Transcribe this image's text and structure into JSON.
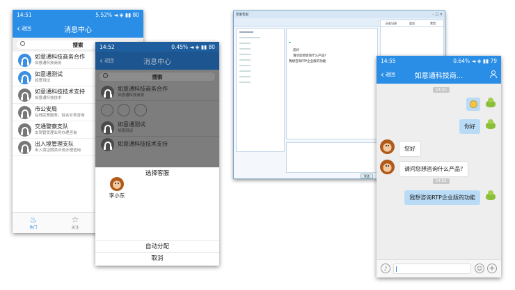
{
  "phone1": {
    "time": "14:51",
    "status_right": "5.52%",
    "battery": "80",
    "back": "返回",
    "title": "消息中心",
    "search": "搜索",
    "items": [
      {
        "name": "如意通科技商务合作",
        "sub": "如意通科技商务"
      },
      {
        "name": "如意通测试",
        "sub": "如意测试"
      },
      {
        "name": "如意通科技技术支持",
        "sub": "如意通科技技术"
      },
      {
        "name": "市公安局",
        "sub": "在线民警服务，综合业务咨询"
      },
      {
        "name": "交通警察支队",
        "sub": "车驾管受理业务办理咨询"
      },
      {
        "name": "出入境管理支队",
        "sub": "出入境证照类业务办理咨询"
      }
    ],
    "tabs": [
      {
        "label": "热门"
      },
      {
        "label": "关注"
      }
    ]
  },
  "phone2": {
    "time": "14:52",
    "status_right": "0.45%",
    "battery": "80",
    "back": "返回",
    "title": "消息中心",
    "search": "搜索",
    "items": [
      {
        "name": "如意通科技商务合作",
        "sub": "如意通科技商务"
      },
      {
        "name": "如意通测试",
        "sub": "如意测试"
      },
      {
        "name": "如意通科技技术支持",
        "sub": ""
      }
    ],
    "sheet_title": "选择客服",
    "agent_name": "李小东",
    "auto_assign": "自动分配",
    "cancel": "取消"
  },
  "desktop": {
    "title": "客服客服",
    "tabs": [
      "历史记录",
      "会员",
      "常用"
    ],
    "msgs": [
      "您好",
      "请问您想咨询什么产品?",
      "我想咨询RTP企业版的功能"
    ],
    "send": "发送"
  },
  "phone3": {
    "time": "14:55",
    "status_right": "0.64%",
    "battery": "79",
    "back": "返回",
    "title": "如意通科技商...",
    "ts1": "14:52",
    "ts2": "14:55",
    "msg_me_1": "你好",
    "msg_other_1": "您好",
    "msg_other_2": "请问您想咨询什么产品?",
    "msg_me_2": "我想咨询RTP企业版的功能"
  },
  "colors": {
    "blue": "#2a8ee6",
    "dark_blue": "#1e5e9e",
    "bubble": "#b9dbf6"
  }
}
